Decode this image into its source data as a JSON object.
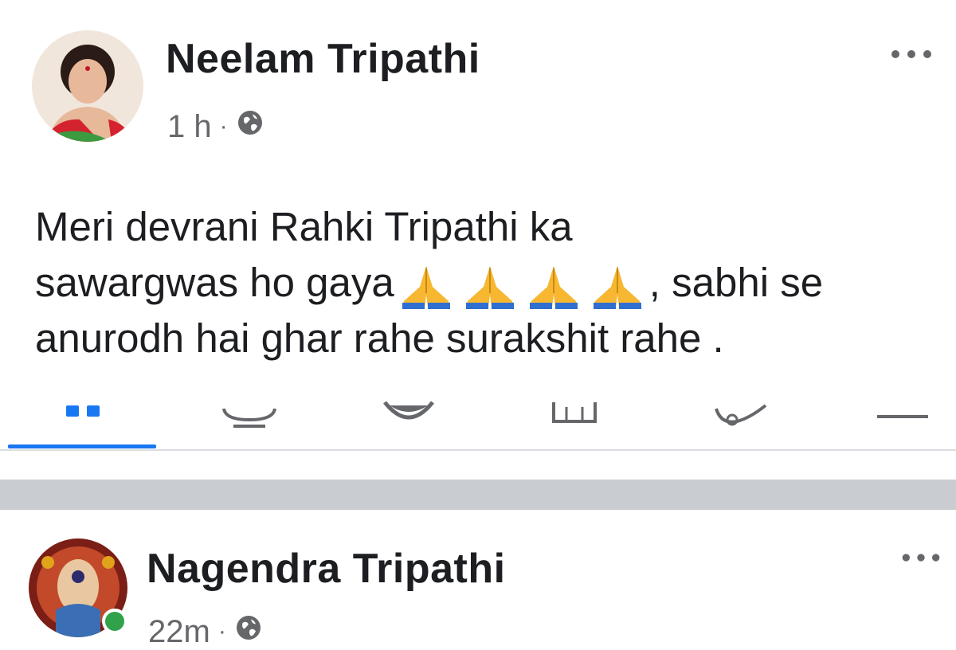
{
  "post1": {
    "author": "Neelam Tripathi",
    "time": "1 h",
    "separator": "·",
    "privacy_icon": "globe-icon",
    "more_icon": "more-horizontal-icon",
    "text_line1": "Meri devrani Rahki Tripathi  ka",
    "text_line2_before": "sawargwas ho gaya",
    "text_line2_after": ", sabhi se",
    "text_line3": "anurodh hai ghar rahe surakshit rahe .",
    "emoji": "folded-hands-icon",
    "emoji_count": 4
  },
  "reaction_tabs": [
    {
      "icon": "all-reactions-icon",
      "active": true
    },
    {
      "icon": "like-icon",
      "active": false
    },
    {
      "icon": "haha-icon",
      "active": false
    },
    {
      "icon": "care-icon",
      "active": false
    },
    {
      "icon": "wow-icon",
      "active": false
    },
    {
      "icon": "more-reactions-icon",
      "active": false
    }
  ],
  "post2": {
    "author": "Nagendra Tripathi",
    "time": "22m",
    "separator": "·",
    "privacy_icon": "globe-icon",
    "more_icon": "more-horizontal-icon",
    "online": true
  },
  "colors": {
    "accent": "#1877f2",
    "meta_text": "#65676b",
    "online": "#31a24c"
  }
}
